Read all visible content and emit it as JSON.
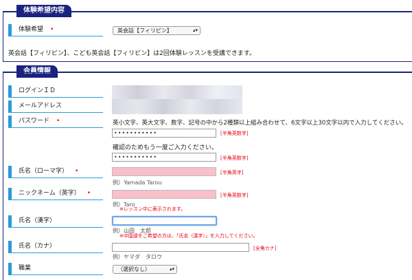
{
  "section1": {
    "title": "体験希望内容",
    "label": "体験希望",
    "select_value": "英会話【フィリピン】",
    "info": "英会話【フィリピン】、こども英会話【フィリピン】は2回体験レッスンを受講できます。"
  },
  "section2": {
    "title": "会員情報",
    "login_id": {
      "label": "ログインＩＤ"
    },
    "email": {
      "label": "メールアドレス"
    },
    "password": {
      "label": "パスワード",
      "hint": "英小文字、英大文字、数字、記号の中から2種類以上組み合わせて、6文字以上30文字以内で入力してください。",
      "value": "•••••••••••",
      "note": "[半角英数字]",
      "confirm_text": "確認のためもう一度ご入力ください。",
      "confirm_value": "•••••••••••",
      "confirm_note": "[半角英数字]"
    },
    "name_roma": {
      "label": "氏名（ローマ字）",
      "note": "[半角英字]",
      "example": "例）Yamada Tarou"
    },
    "nickname": {
      "label": "ニックネーム（英字）",
      "note": "[半角英数字]",
      "example": "例）Taro",
      "warning": "※レッスン中に表示されます。"
    },
    "name_kanji": {
      "label": "氏名（漢字）",
      "example": "例）山田　太郎",
      "warning": "※中国語をご希望の方は、「氏名（漢字）」を入力してください。"
    },
    "name_kana": {
      "label": "氏名（カナ）",
      "note": "[全角カナ]",
      "example": "例）ヤマダ　タロウ"
    },
    "occupation": {
      "label": "職業",
      "select_value": "（選択なし）"
    }
  },
  "required_mark": "•",
  "colors": {
    "navy": "#1a237e",
    "blue": "#2a9bd9",
    "red": "#e60012",
    "pink": "#f9c0c9"
  }
}
